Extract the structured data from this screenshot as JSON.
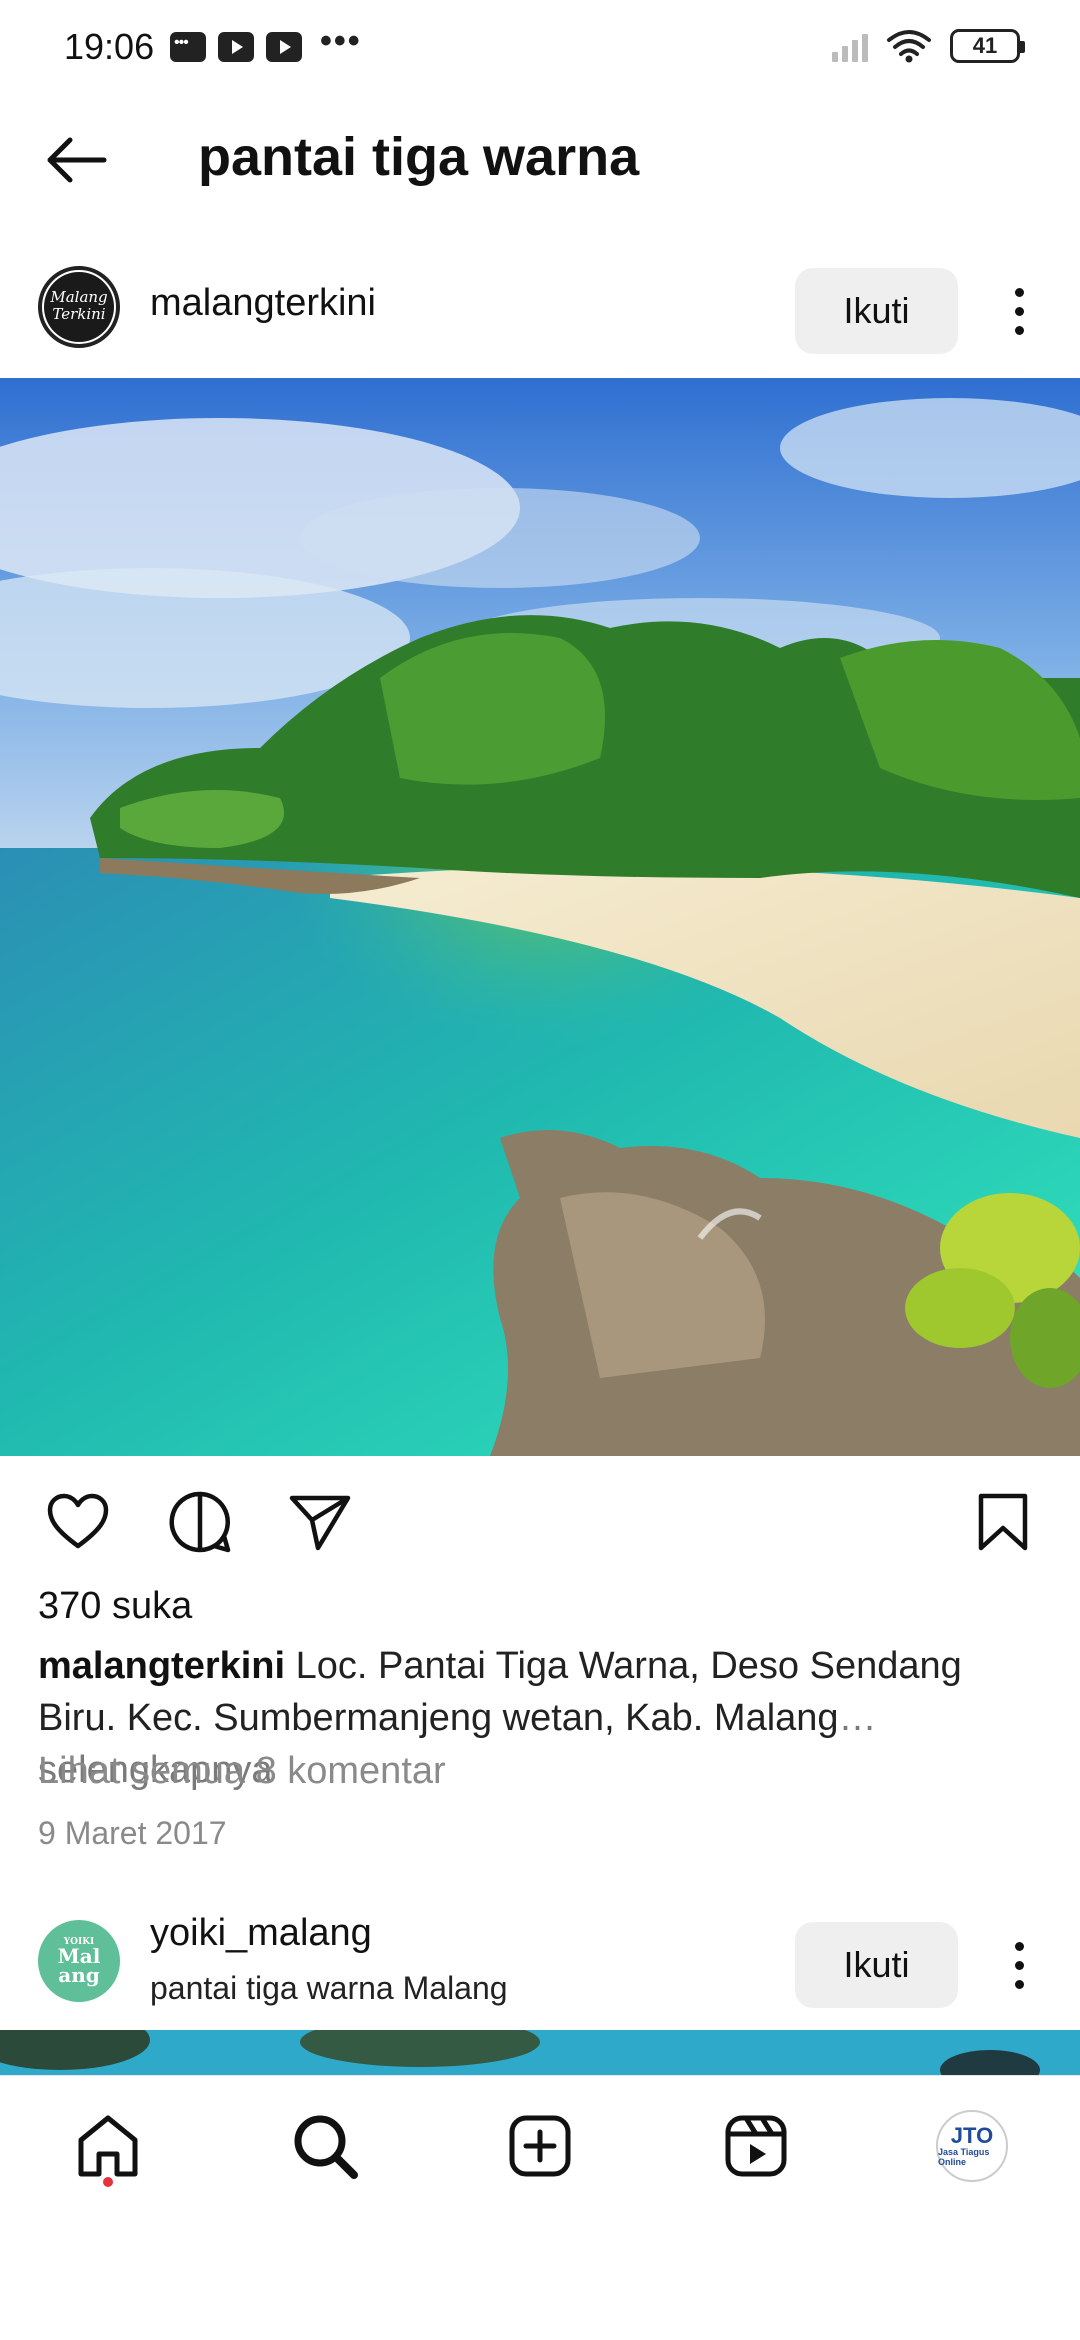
{
  "status_bar": {
    "time": "19:06",
    "battery": "41",
    "left_icons": [
      "message-icon",
      "youtube-icon",
      "youtube-icon",
      "more-dots-icon"
    ],
    "right_icons": [
      "signal-icon",
      "wifi-icon",
      "battery-icon"
    ]
  },
  "header": {
    "title": "pantai tiga warna",
    "back_icon": "arrow-left-icon"
  },
  "post1": {
    "username": "malangterkini",
    "avatar_text": [
      "Malang",
      "Terkini"
    ],
    "follow_label": "Ikuti",
    "likes": "370 suka",
    "caption_user": "malangterkini",
    "caption_text": " Loc. Pantai Tiga Warna, Deso Sendang Biru. Kec. Sumbermanjeng wetan, Kab. Malang",
    "caption_more": "… selengkapnya",
    "comments_link": "Lihat semua 8 komentar",
    "date": "9 Maret 2017"
  },
  "post2": {
    "username": "yoiki_malang",
    "subtitle": "pantai tiga warna Malang",
    "avatar_text": [
      "YOIKI",
      "Mal",
      "ang"
    ],
    "follow_label": "Ikuti"
  },
  "bottom_nav": {
    "items": [
      "home-icon",
      "search-icon",
      "create-icon",
      "reels-icon",
      "profile-avatar"
    ],
    "profile_text": [
      "JTO",
      "Jasa Tiagus Online"
    ]
  },
  "colors": {
    "follow_bg": "#efefef",
    "notification_dot": "#e5323b",
    "muted_text": "#8a8a8a"
  }
}
